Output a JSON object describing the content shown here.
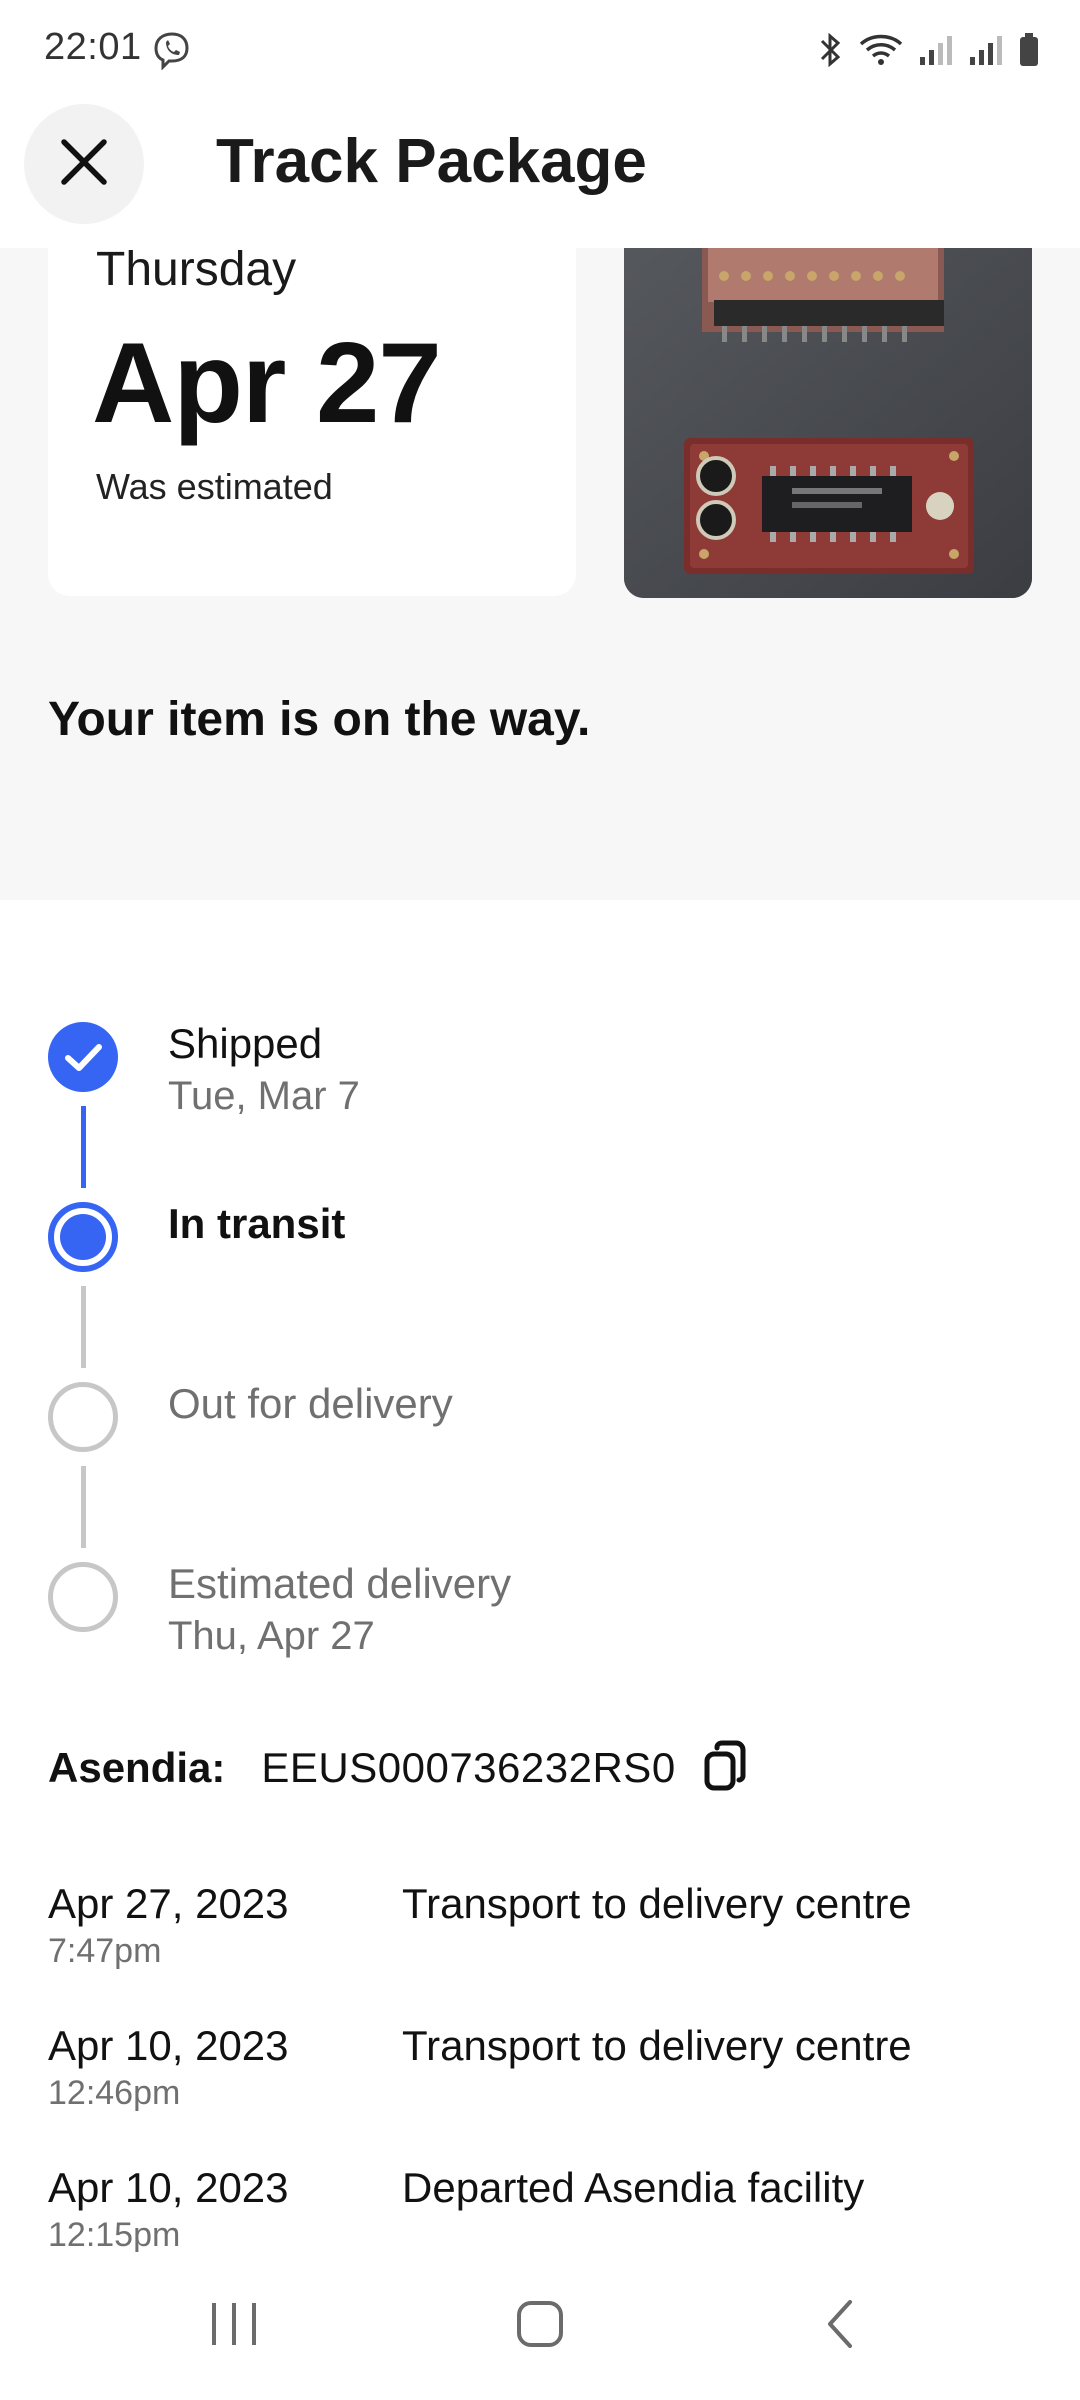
{
  "status_bar": {
    "time": "22:01",
    "icons": [
      "viber-icon",
      "bluetooth-icon",
      "wifi-icon",
      "signal-icon",
      "signal-icon",
      "battery-icon"
    ]
  },
  "header": {
    "title": "Track Package",
    "close_icon": "close-icon"
  },
  "delivery": {
    "weekday": "Thursday",
    "date": "Apr 27",
    "note": "Was estimated",
    "message": "Your item is on the way."
  },
  "timeline": [
    {
      "label": "Shipped",
      "sub": "Tue, Mar 7",
      "state": "done"
    },
    {
      "label": "In transit",
      "sub": "",
      "state": "current"
    },
    {
      "label": "Out for delivery",
      "sub": "",
      "state": "pending"
    },
    {
      "label": "Estimated delivery",
      "sub": "Thu, Apr 27",
      "state": "pending"
    }
  ],
  "carrier": {
    "name": "Asendia:",
    "tracking_number": "EEUS000736232RS0",
    "copy_icon": "copy-icon"
  },
  "events": [
    {
      "date": "Apr 27, 2023",
      "time": "7:47pm",
      "description": "Transport to delivery centre"
    },
    {
      "date": "Apr 10, 2023",
      "time": "12:46pm",
      "description": "Transport to delivery centre"
    },
    {
      "date": "Apr 10, 2023",
      "time": "12:15pm",
      "description": "Departed Asendia facility"
    }
  ],
  "colors": {
    "accent": "#3665f3",
    "muted": "#707070",
    "pending": "#c7c7c7",
    "summary_background": "#f7f7f7"
  },
  "nav": {
    "recents_icon": "recents-icon",
    "home_icon": "home-icon",
    "back_icon": "back-icon"
  }
}
